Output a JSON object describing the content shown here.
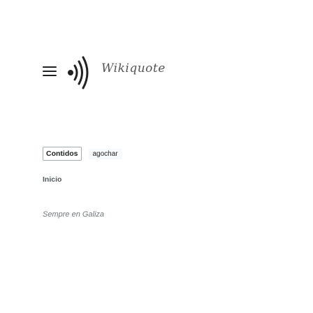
{
  "header": {
    "menu_icon": "hamburger-menu-icon",
    "logo_icon": "sound-waves-logo-icon",
    "wordmark": "Wikiquote"
  },
  "toc": {
    "title": "Contidos",
    "toggle_label": "agochar",
    "items": [
      {
        "label": "Inicio"
      }
    ]
  },
  "main": {
    "tagline": "Sempre en Galiza"
  },
  "colors": {
    "text": "#202122",
    "muted": "#72777d",
    "border": "#a2a9b1"
  }
}
